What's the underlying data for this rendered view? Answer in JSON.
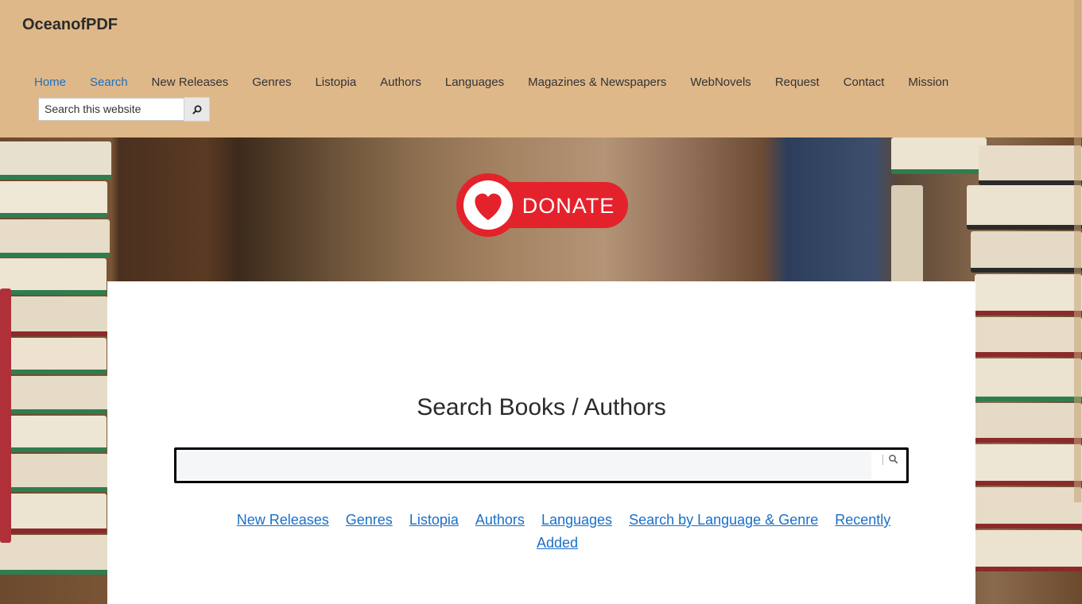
{
  "site": {
    "title": "OceanofPDF"
  },
  "nav": {
    "items": [
      {
        "label": "Home",
        "active": true
      },
      {
        "label": "Search",
        "active": true
      },
      {
        "label": "New Releases",
        "active": false
      },
      {
        "label": "Genres",
        "active": false
      },
      {
        "label": "Listopia",
        "active": false
      },
      {
        "label": "Authors",
        "active": false
      },
      {
        "label": "Languages",
        "active": false
      },
      {
        "label": "Magazines & Newspapers",
        "active": false
      },
      {
        "label": "WebNovels",
        "active": false
      },
      {
        "label": "Request",
        "active": false
      },
      {
        "label": "Contact",
        "active": false
      },
      {
        "label": "Mission",
        "active": false
      }
    ]
  },
  "header_search": {
    "placeholder": "Search this website",
    "button_icon": "search-icon"
  },
  "donate": {
    "label": "DONATE",
    "icon": "heart-icon"
  },
  "main": {
    "heading": "Search Books / Authors",
    "search_value": "",
    "search_icon": "search-icon",
    "links": [
      "New Releases",
      "Genres",
      "Listopia",
      "Authors",
      "Languages",
      "Search by Language & Genre",
      "Recently Added"
    ]
  },
  "colors": {
    "header_bg": "#dfb88a",
    "link_blue": "#1a6fc9",
    "nav_active": "#1d6fbf",
    "donate_red": "#e4222c"
  }
}
